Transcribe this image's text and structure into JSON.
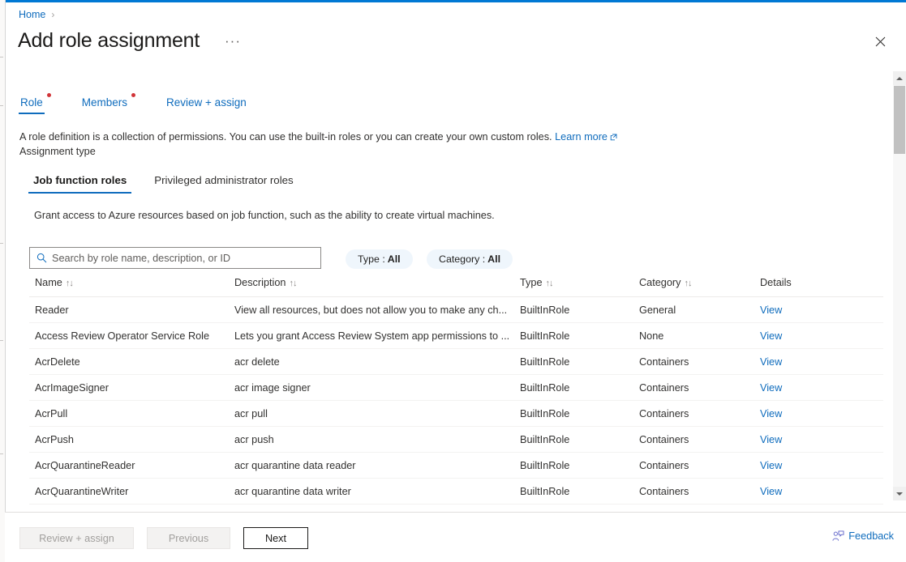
{
  "breadcrumb": {
    "home": "Home",
    "separator": "›"
  },
  "header": {
    "title": "Add role assignment",
    "more_label": "···",
    "close_label": "Close"
  },
  "wizard_tabs": [
    {
      "label": "Role",
      "active": true,
      "required": true
    },
    {
      "label": "Members",
      "active": false,
      "required": true
    },
    {
      "label": "Review + assign",
      "active": false,
      "required": false
    }
  ],
  "description": {
    "text": "A role definition is a collection of permissions. You can use the built-in roles or you can create your own custom roles.",
    "link": "Learn more",
    "assignment_type_label": "Assignment type"
  },
  "pivot": {
    "items": [
      {
        "label": "Job function roles",
        "active": true
      },
      {
        "label": "Privileged administrator roles",
        "active": false
      }
    ],
    "description": "Grant access to Azure resources based on job function, such as the ability to create virtual machines."
  },
  "search": {
    "placeholder": "Search by role name, description, or ID",
    "value": ""
  },
  "filters": [
    {
      "name": "Type",
      "value": "All"
    },
    {
      "name": "Category",
      "value": "All"
    }
  ],
  "table": {
    "columns": [
      {
        "label": "Name",
        "sortable": true
      },
      {
        "label": "Description",
        "sortable": true
      },
      {
        "label": "Type",
        "sortable": true
      },
      {
        "label": "Category",
        "sortable": true
      },
      {
        "label": "Details",
        "sortable": false
      }
    ],
    "sort_glyph": "↑↓",
    "rows": [
      {
        "name": "Reader",
        "description": "View all resources, but does not allow you to make any ch...",
        "type": "BuiltInRole",
        "category": "General",
        "details": "View"
      },
      {
        "name": "Access Review Operator Service Role",
        "description": "Lets you grant Access Review System app permissions to ...",
        "type": "BuiltInRole",
        "category": "None",
        "details": "View"
      },
      {
        "name": "AcrDelete",
        "description": "acr delete",
        "type": "BuiltInRole",
        "category": "Containers",
        "details": "View"
      },
      {
        "name": "AcrImageSigner",
        "description": "acr image signer",
        "type": "BuiltInRole",
        "category": "Containers",
        "details": "View"
      },
      {
        "name": "AcrPull",
        "description": "acr pull",
        "type": "BuiltInRole",
        "category": "Containers",
        "details": "View"
      },
      {
        "name": "AcrPush",
        "description": "acr push",
        "type": "BuiltInRole",
        "category": "Containers",
        "details": "View"
      },
      {
        "name": "AcrQuarantineReader",
        "description": "acr quarantine data reader",
        "type": "BuiltInRole",
        "category": "Containers",
        "details": "View"
      },
      {
        "name": "AcrQuarantineWriter",
        "description": "acr quarantine data writer",
        "type": "BuiltInRole",
        "category": "Containers",
        "details": "View"
      }
    ]
  },
  "footer": {
    "review_assign": "Review + assign",
    "previous": "Previous",
    "next": "Next",
    "feedback": "Feedback"
  },
  "colors": {
    "accent": "#0078d4",
    "link": "#0f6cbd",
    "required_dot": "#d13438",
    "pill_bg": "#eff6fc"
  }
}
